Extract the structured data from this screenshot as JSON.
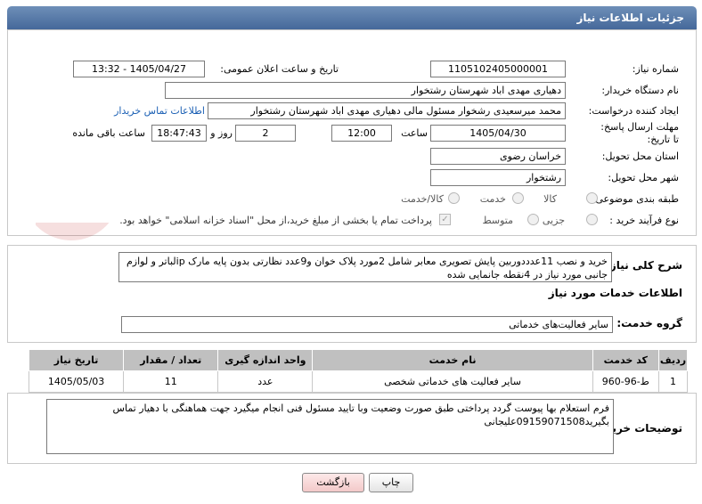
{
  "page_title": "جزئیات اطلاعات نیاز",
  "fields": {
    "need_number_label": "شماره نیاز:",
    "need_number": "1105102405000001",
    "announce_label": "تاریخ و ساعت اعلان عمومی:",
    "announce_value": "1405/04/27 - 13:32",
    "buyer_org_label": "نام دستگاه خریدار:",
    "buyer_org": "دهیاری مهدی اباد شهرستان رشتخوار",
    "creator_label": "ایجاد کننده درخواست:",
    "creator": "محمد میرسعیدی رشخوار مسئول مالی دهیاری مهدی اباد شهرستان رشتخوار",
    "contact_link": "اطلاعات تماس خریدار",
    "deadline_label": "مهلت ارسال پاسخ: تا تاریخ:",
    "deadline_date": "1405/04/30",
    "time_label": "ساعت",
    "deadline_time": "12:00",
    "days_value": "2",
    "days_label": "روز و",
    "remaining_time": "18:47:43",
    "remaining_label": "ساعت باقی مانده",
    "province_label": "استان محل تحویل:",
    "province": "خراسان رضوی",
    "city_label": "شهر محل تحویل:",
    "city": "رشتخوار",
    "category_label": "طبقه بندی موضوعی:",
    "category_options": [
      "کالا",
      "خدمت",
      "کالا/خدمت"
    ],
    "process_label": "نوع فرآیند خرید :",
    "process_options": [
      "جزیی",
      "متوسط"
    ],
    "payment_note": "پرداخت تمام یا بخشی از مبلغ خرید،از محل \"اسناد خزانه اسلامی\" خواهد بود."
  },
  "description": {
    "label": "شرح کلی نیاز:",
    "text": "خرید و نصب 11عدددوربین پایش تصویری معابر شامل 2مورد پلاک خوان  و9عدد نظارتی بدون پایه مارک ipلباتر و لوازم جانبی مورد نیاز  در 4نقطه جانمایی شده"
  },
  "services": {
    "section_title": "اطلاعات خدمات مورد نیاز",
    "group_label": "گروه خدمت:",
    "group_value": "سایر فعالیت‌های خدماتی",
    "columns": [
      "ردیف",
      "کد خدمت",
      "نام خدمت",
      "واحد اندازه گیری",
      "تعداد / مقدار",
      "تاریخ نیاز"
    ],
    "rows": [
      {
        "row": "1",
        "code": "ط-96-960",
        "name": "سایر فعالیت های خدماتی شخصی",
        "unit": "عدد",
        "qty": "11",
        "date": "1405/05/03"
      }
    ]
  },
  "buyer_notes": {
    "label": "توضیحات خریدار:",
    "text": "فرم استعلام بها پیوست گردد پرداختی طبق صورت وضعیت وبا تایید مسئول فنی انجام میگیرد جهت هماهنگی با دهیار تماس بگیرید09159071508علیجانی"
  },
  "buttons": {
    "print": "چاپ",
    "back": "بازگشت"
  },
  "watermark_text": "AriaTender.net"
}
